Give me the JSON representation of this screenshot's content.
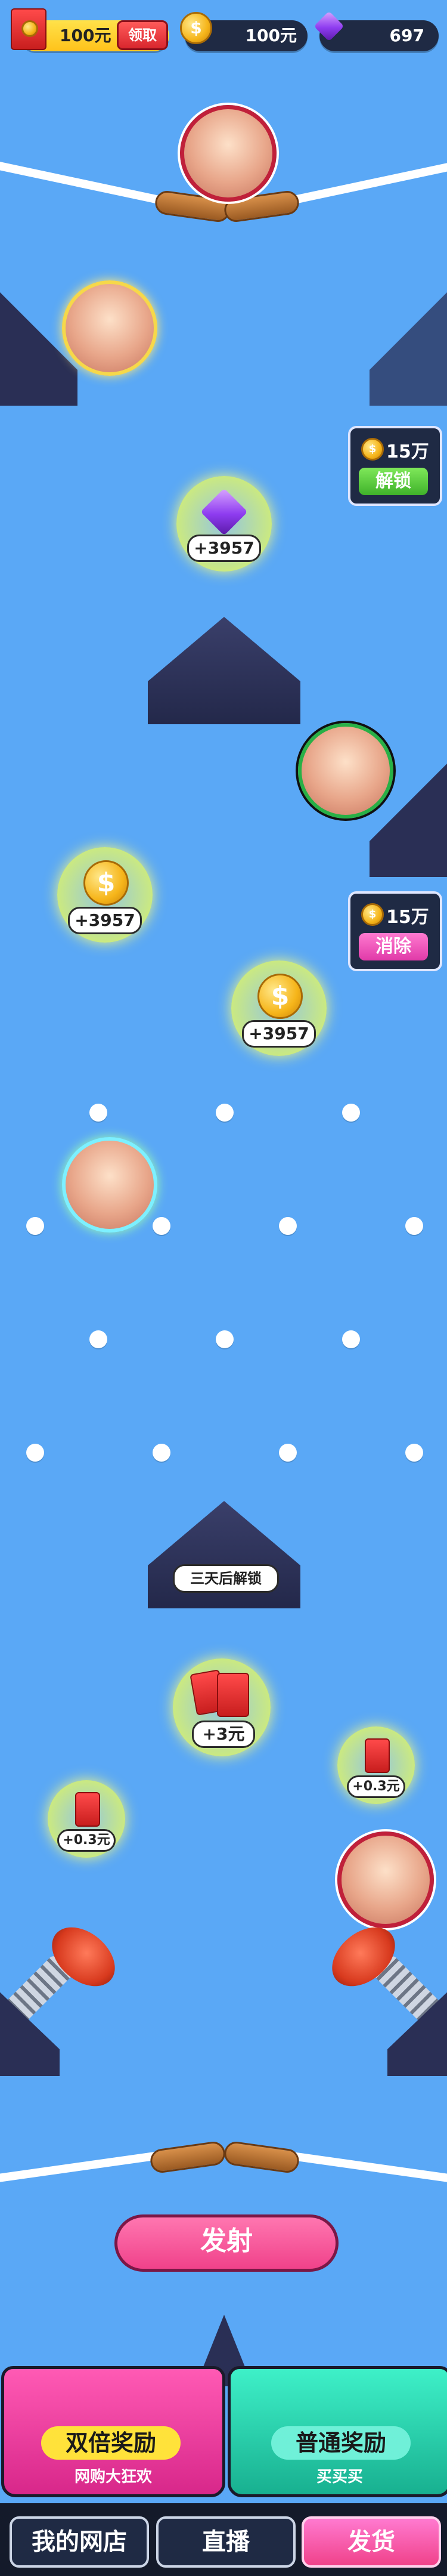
{
  "top_bar": {
    "cash_amount": "100元",
    "claim_label": "领取",
    "coin_amount": "100元",
    "gem_amount": "697"
  },
  "panels": {
    "unlock": {
      "cost": "15万",
      "button": "解锁"
    },
    "clear": {
      "cost": "15万",
      "button": "消除"
    }
  },
  "rewards": {
    "gem_value": "+3957",
    "coin1_value": "+3957",
    "coin2_value": "+3957",
    "envelope_big": "+3元",
    "envelope_small_right": "+0.3元",
    "envelope_small_left": "+0.3元"
  },
  "lock_text": "三天后解锁",
  "fire_label": "发射",
  "chests": {
    "double": {
      "title": "双倍奖励",
      "subtitle": "网购大狂欢"
    },
    "normal": {
      "title": "普通奖励",
      "subtitle": "买买买"
    }
  },
  "bottom_nav": {
    "shop": "我的网店",
    "live": "直播",
    "ship": "发货"
  },
  "colors": {
    "background": "#5aa8f6",
    "dark_navy": "#1f2a44",
    "pink": "#f0428a",
    "teal": "#28d2b0",
    "green": "#5fd44a"
  },
  "icons": [
    "red-envelope-icon",
    "coin-icon",
    "gem-icon",
    "dollar-coin-icon",
    "lock-icon"
  ]
}
